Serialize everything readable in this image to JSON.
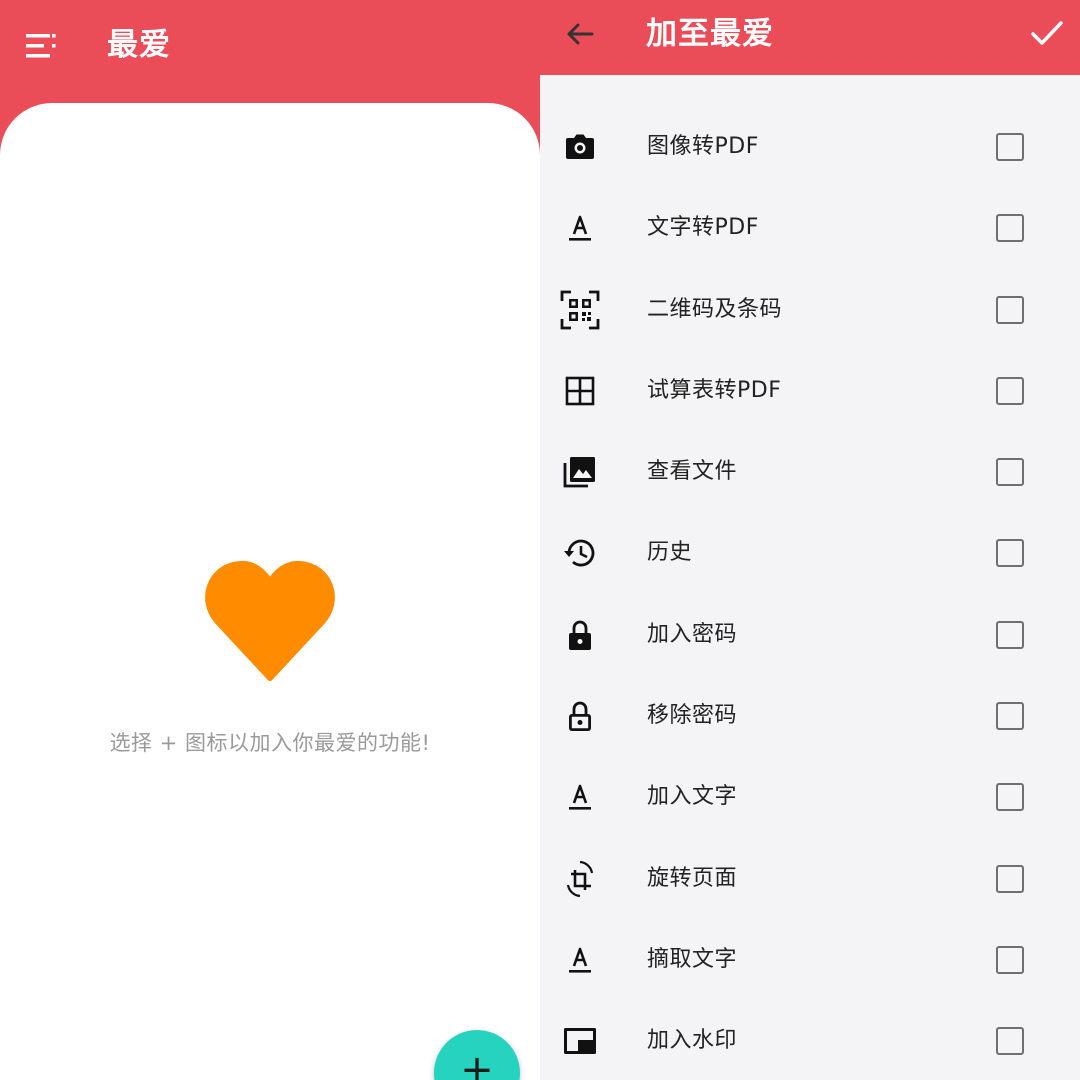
{
  "left": {
    "title": "最爱",
    "empty_message": "选择 + 图标以加入你最爱的功能!",
    "fab_symbol": "+",
    "colors": {
      "appbar": "#ea4c58",
      "heart": "#ff8c00",
      "fab": "#26d3bf"
    }
  },
  "right": {
    "title": "加至最爱",
    "items": [
      {
        "label": "图像转PDF",
        "icon": "camera-icon",
        "checked": false
      },
      {
        "label": "文字转PDF",
        "icon": "text-format-icon",
        "checked": false
      },
      {
        "label": "二维码及条码",
        "icon": "qr-code-scanner-icon",
        "checked": false
      },
      {
        "label": "试算表转PDF",
        "icon": "grid-table-icon",
        "checked": false
      },
      {
        "label": "查看文件",
        "icon": "photo-library-icon",
        "checked": false
      },
      {
        "label": "历史",
        "icon": "history-icon",
        "checked": false
      },
      {
        "label": "加入密码",
        "icon": "lock-icon",
        "checked": false
      },
      {
        "label": "移除密码",
        "icon": "lock-open-icon",
        "checked": false
      },
      {
        "label": "加入文字",
        "icon": "text-format-icon",
        "checked": false
      },
      {
        "label": "旋转页面",
        "icon": "crop-rotate-icon",
        "checked": false
      },
      {
        "label": "摘取文字",
        "icon": "text-format-icon",
        "checked": false
      },
      {
        "label": "加入水印",
        "icon": "watermark-icon",
        "checked": false
      }
    ]
  }
}
